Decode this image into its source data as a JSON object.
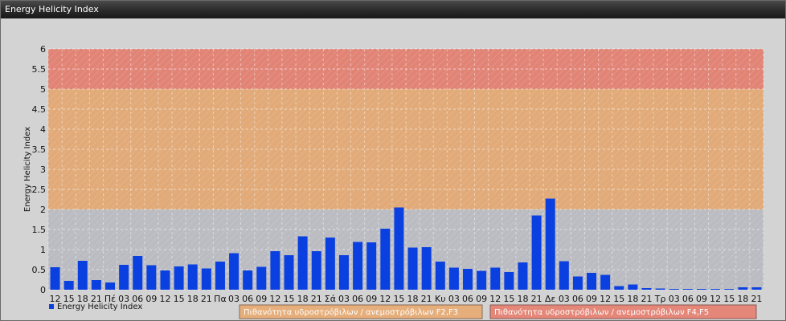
{
  "window": {
    "title": "Energy Helicity Index"
  },
  "colors": {
    "bar": "#0a3fe0",
    "band_f2f3": "#e8a76b",
    "band_f4f5": "#e57d6e",
    "plot_bg": "#bbbcc2"
  },
  "legend": {
    "series_label": "Energy Helicity Index",
    "band_f2f3": "Πιθανότητα υδροστρόβιλων / ανεμοστρόβιλων F2,F3",
    "band_f4f5": "Πιθανότητα υδροστρόβιλων / ανεμοστρόβιλων F4,F5"
  },
  "chart_data": {
    "type": "bar",
    "ylabel": "Energy Helicity Index",
    "ylim": [
      0,
      6
    ],
    "yticks": [
      "0",
      "0.5",
      "1",
      "1.5",
      "2",
      "2.5",
      "3",
      "3.5",
      "4",
      "4.5",
      "5",
      "5.5",
      "6"
    ],
    "grid": true,
    "legend_position": "bottom",
    "bands": [
      {
        "label": "Πιθανότητα υδροστρόβιλων / ανεμοστρόβιλων F2,F3",
        "from": 2,
        "to": 5
      },
      {
        "label": "Πιθανότητα υδροστρόβιλων / ανεμοστρόβιλων F4,F5",
        "from": 5,
        "to": 6
      }
    ],
    "categories": [
      "12",
      "15",
      "18",
      "21",
      "Πέ",
      "03",
      "06",
      "09",
      "12",
      "15",
      "18",
      "21",
      "Πα",
      "03",
      "06",
      "09",
      "12",
      "15",
      "18",
      "21",
      "Σά",
      "03",
      "06",
      "09",
      "12",
      "15",
      "18",
      "21",
      "Κυ",
      "03",
      "06",
      "09",
      "12",
      "15",
      "18",
      "21",
      "Δε",
      "03",
      "06",
      "09",
      "12",
      "15",
      "18",
      "21",
      "Τρ",
      "03",
      "06",
      "09",
      "12",
      "15",
      "18",
      "21"
    ],
    "series": [
      {
        "name": "Energy Helicity Index",
        "values": [
          0.56,
          0.22,
          0.72,
          0.24,
          0.18,
          0.62,
          0.84,
          0.61,
          0.48,
          0.58,
          0.63,
          0.53,
          0.7,
          0.91,
          0.48,
          0.57,
          0.96,
          0.86,
          1.33,
          0.96,
          1.3,
          0.86,
          1.19,
          1.18,
          1.52,
          2.05,
          1.05,
          1.06,
          0.7,
          0.55,
          0.52,
          0.47,
          0.55,
          0.44,
          0.68,
          1.85,
          2.27,
          0.71,
          0.33,
          0.42,
          0.37,
          0.09,
          0.13,
          0.04,
          0.03,
          0.02,
          0.02,
          0.02,
          0.02,
          0.02,
          0.06,
          0.06
        ]
      }
    ]
  }
}
